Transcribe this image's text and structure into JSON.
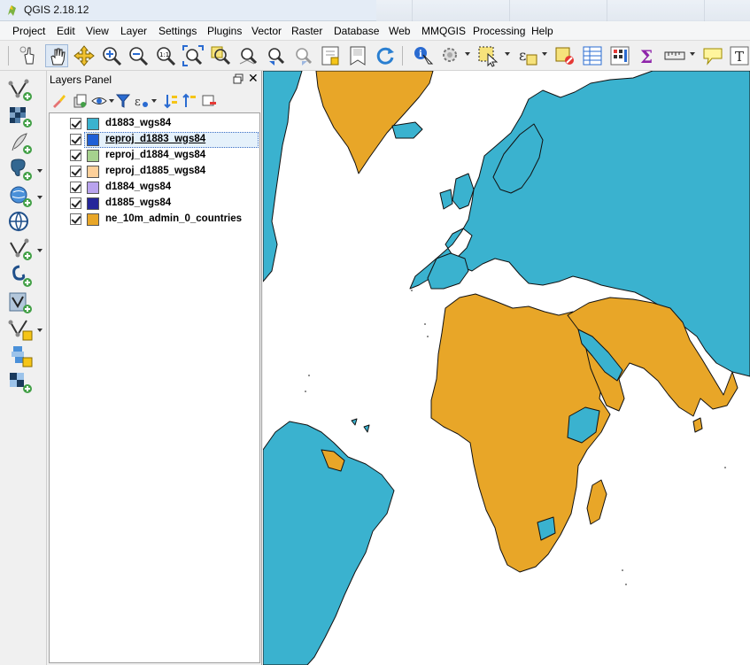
{
  "window": {
    "title": "QGIS 2.18.12"
  },
  "menubar": {
    "items": [
      "Project",
      "Edit",
      "View",
      "Layer",
      "Settings",
      "Plugins",
      "Vector",
      "Raster",
      "Database",
      "Web",
      "MMQGIS",
      "Processing",
      "Help"
    ]
  },
  "layers_panel": {
    "title": "Layers Panel",
    "layers": [
      {
        "name": "d1883_wgs84",
        "color": "#3ab2cf",
        "checked": true,
        "selected": false
      },
      {
        "name": "reproj_d1883_wgs84",
        "color": "#1f5fd6",
        "checked": true,
        "selected": true
      },
      {
        "name": "reproj_d1884_wgs84",
        "color": "#a6d18e",
        "checked": true,
        "selected": false
      },
      {
        "name": "reproj_d1885_wgs84",
        "color": "#fdd09a",
        "checked": true,
        "selected": false
      },
      {
        "name": "d1884_wgs84",
        "color": "#b9a3ee",
        "checked": true,
        "selected": false
      },
      {
        "name": "d1885_wgs84",
        "color": "#25269a",
        "checked": true,
        "selected": false
      },
      {
        "name": "ne_10m_admin_0_countries",
        "color": "#e8a628",
        "checked": true,
        "selected": false
      }
    ]
  },
  "map": {
    "background": "#ffffff",
    "fill_blue": "#3ab2cf",
    "fill_orange": "#e8a628",
    "outline": "#111111"
  }
}
